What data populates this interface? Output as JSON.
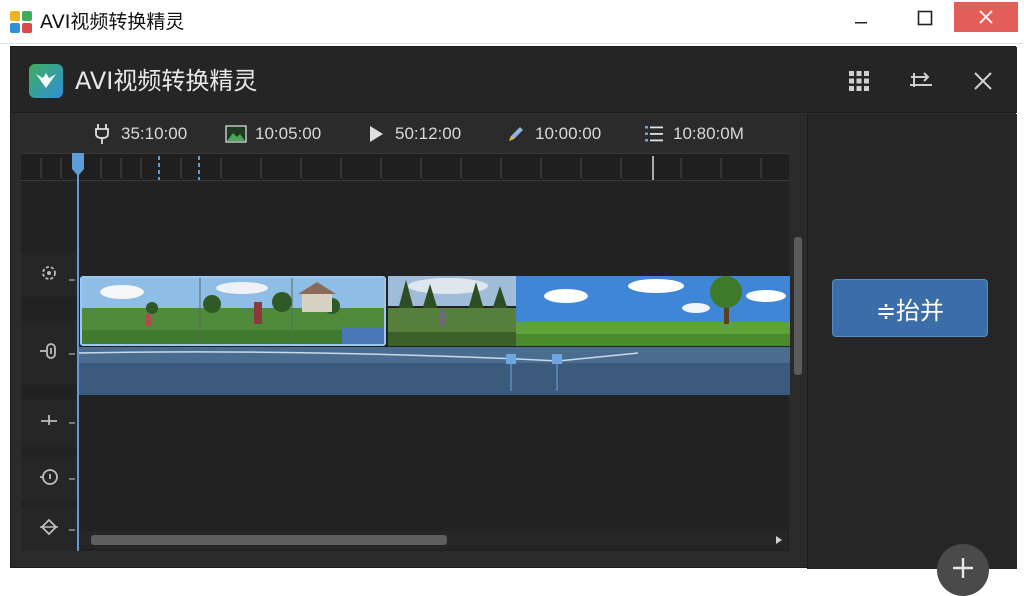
{
  "window": {
    "title": "AVI视频转换精灵",
    "close_color": "#e25e59"
  },
  "app": {
    "title": "AVI视频转换精灵",
    "header_icons": [
      "grid-icon",
      "swap-icon",
      "close-icon"
    ]
  },
  "info_bar": [
    {
      "icon": "plug-icon",
      "value": "35:10:00"
    },
    {
      "icon": "image-icon",
      "value": "10:05:00"
    },
    {
      "icon": "play-icon",
      "value": "50:12:00"
    },
    {
      "icon": "pen-icon",
      "value": "10:00:00"
    },
    {
      "icon": "list-icon",
      "value": "10:80:0M"
    }
  ],
  "track_icons": [
    "settings-gear-icon",
    "audio-clip-icon",
    "plus-cross-icon",
    "timer-icon",
    "diamond-marker-icon"
  ],
  "side_panel": {
    "merge_label": "≑抬并",
    "accent": "#3b6ea8",
    "add_icon": "plus-icon"
  }
}
